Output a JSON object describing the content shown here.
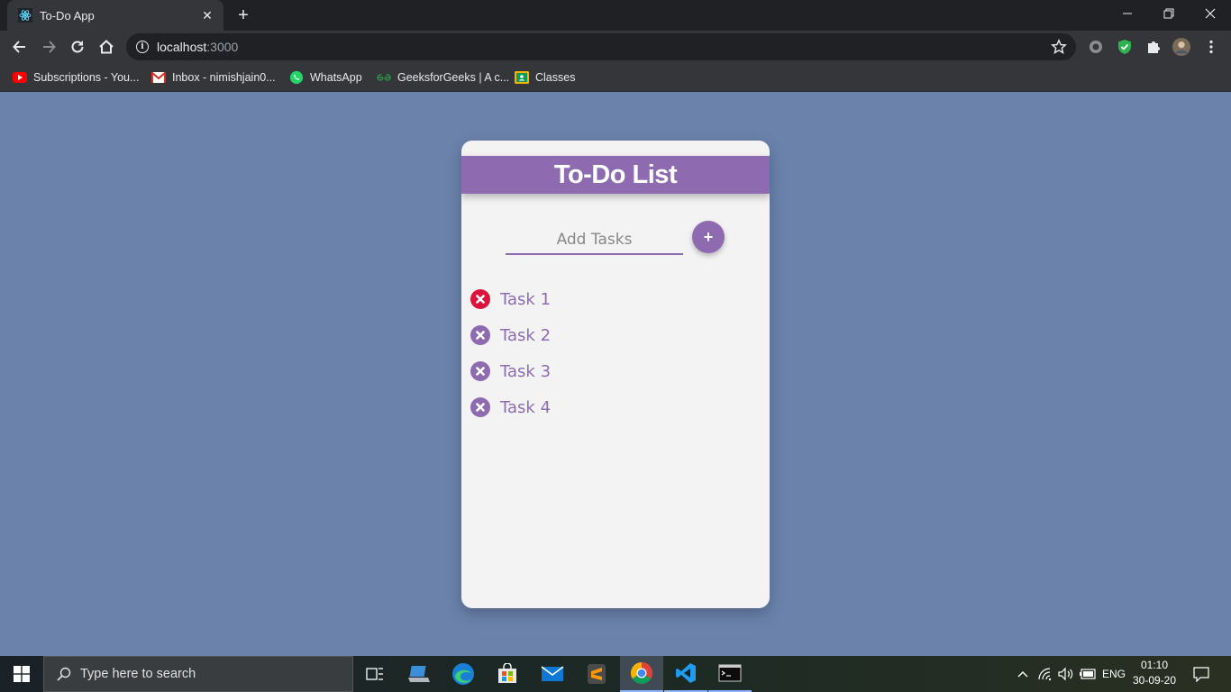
{
  "browser": {
    "tab_title": "To-Do App",
    "tab_close": "✕",
    "new_tab": "+",
    "url_host": "localhost",
    "url_port": ":3000",
    "bookmarks": [
      {
        "label": "Subscriptions - You...",
        "icon": "youtube-icon"
      },
      {
        "label": "Inbox - nimishjain0...",
        "icon": "gmail-icon"
      },
      {
        "label": "WhatsApp",
        "icon": "whatsapp-icon"
      },
      {
        "label": "GeeksforGeeks | A c...",
        "icon": "geeksforgeeks-icon"
      },
      {
        "label": "Classes",
        "icon": "google-classroom-icon"
      }
    ]
  },
  "app": {
    "title": "To-Do List",
    "input_placeholder": "Add Tasks",
    "add_button": "+",
    "accent_color": "#8e6bb0",
    "delete_highlight_color": "#dc143c",
    "tasks": [
      {
        "label": "Task 1",
        "highlighted": true
      },
      {
        "label": "Task 2",
        "highlighted": false
      },
      {
        "label": "Task 3",
        "highlighted": false
      },
      {
        "label": "Task 4",
        "highlighted": false
      }
    ]
  },
  "taskbar": {
    "search_placeholder": "Type here to search",
    "language": "ENG",
    "time": "01:10",
    "date": "30-09-20"
  }
}
